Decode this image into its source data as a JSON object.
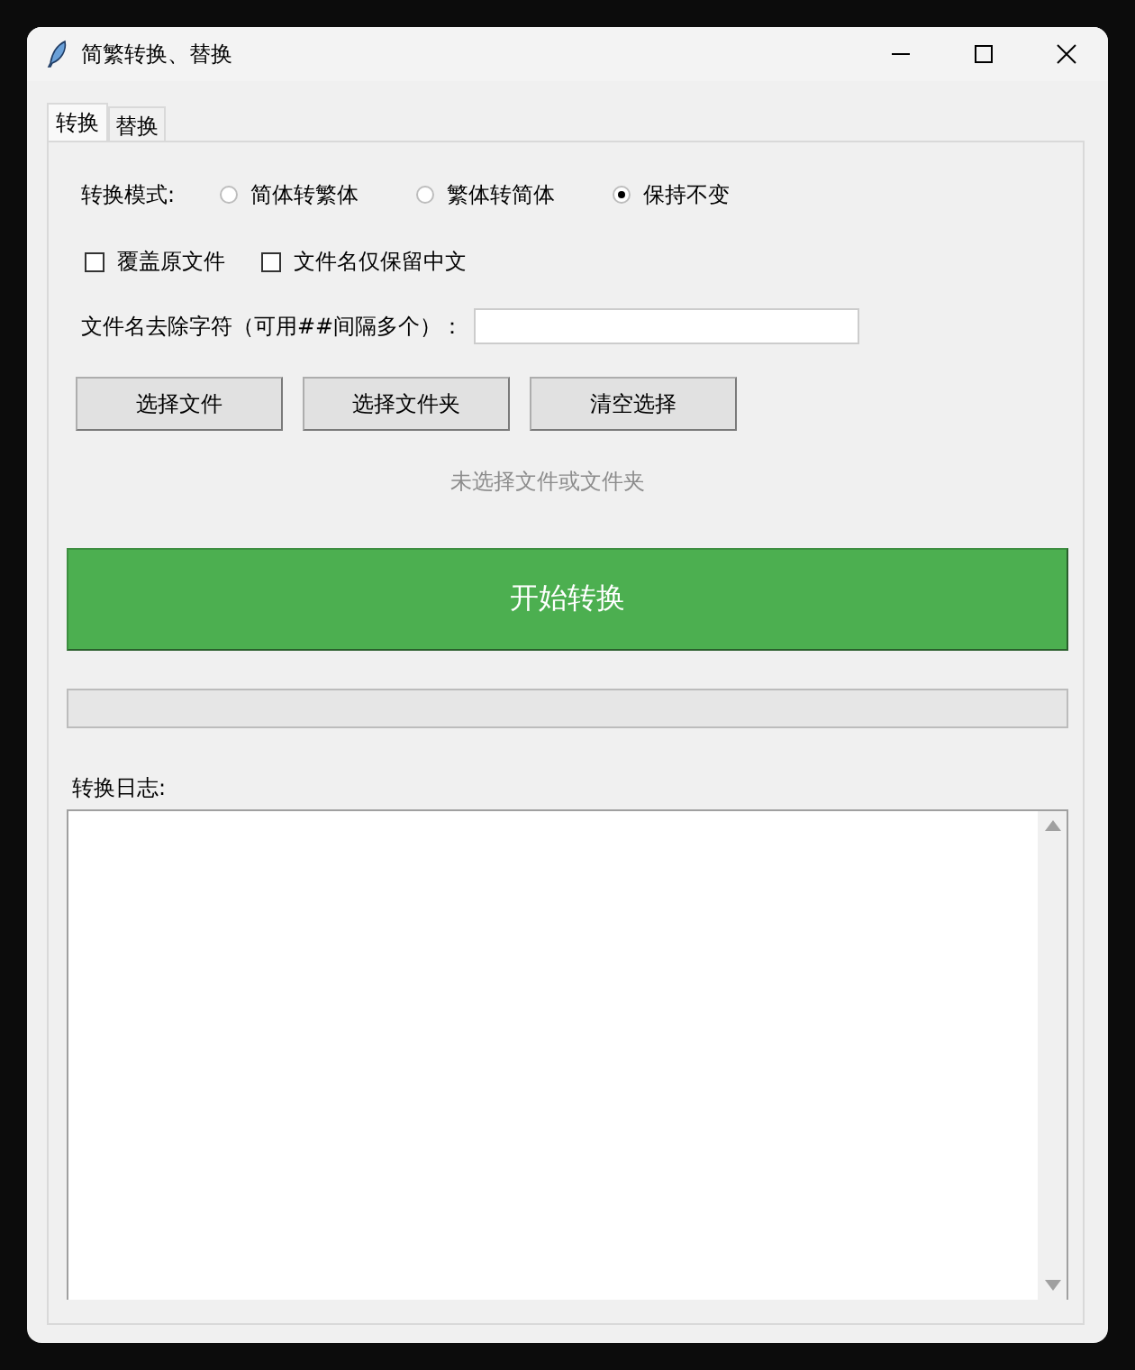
{
  "window": {
    "title": "简繁转换、替换"
  },
  "tabs": [
    {
      "label": "转换",
      "selected": true
    },
    {
      "label": "替换",
      "selected": false
    }
  ],
  "mode": {
    "label": "转换模式:",
    "options": [
      {
        "label": "简体转繁体",
        "selected": false
      },
      {
        "label": "繁体转简体",
        "selected": false
      },
      {
        "label": "保持不变",
        "selected": true
      }
    ]
  },
  "options": [
    {
      "label": "覆盖原文件",
      "checked": false
    },
    {
      "label": "文件名仅保留中文",
      "checked": false
    }
  ],
  "strip_chars": {
    "label": "文件名去除字符（可用##间隔多个）："
  },
  "buttons": [
    "选择文件",
    "选择文件夹",
    "清空选择"
  ],
  "status": "未选择文件或文件夹",
  "start_button": "开始转换",
  "progress": {
    "level": 0
  },
  "log": {
    "label": "转换日志:"
  }
}
